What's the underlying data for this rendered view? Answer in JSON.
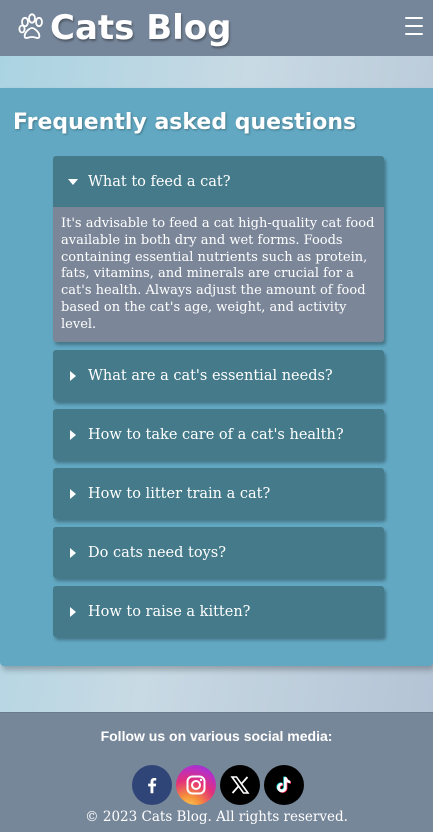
{
  "header": {
    "brand": "Cats Blog",
    "logo_icon": "paw-icon",
    "menu_icon": "hamburger-menu-icon"
  },
  "faq": {
    "title": "Frequently asked questions",
    "items": [
      {
        "question": "What to feed a cat?",
        "expanded": true,
        "answer": "It's advisable to feed a cat high-quality cat food available in both dry and wet forms. Foods containing essential nutrients such as protein, fats, vitamins, and minerals are crucial for a cat's health. Always adjust the amount of food based on the cat's age, weight, and activity level."
      },
      {
        "question": "What are a cat's essential needs?",
        "expanded": false
      },
      {
        "question": "How to take care of a cat's health?",
        "expanded": false
      },
      {
        "question": "How to litter train a cat?",
        "expanded": false
      },
      {
        "question": "Do cats need toys?",
        "expanded": false
      },
      {
        "question": "How to raise a kitten?",
        "expanded": false
      }
    ]
  },
  "footer": {
    "follow_text": "Follow us on various social media:",
    "socials": [
      {
        "name": "facebook",
        "icon": "facebook-icon",
        "color": "#2f4577"
      },
      {
        "name": "instagram",
        "icon": "instagram-icon",
        "color": "#e2307a"
      },
      {
        "name": "x",
        "icon": "x-icon",
        "color": "#000000"
      },
      {
        "name": "tiktok",
        "icon": "tiktok-icon",
        "color": "#000000"
      }
    ],
    "copyright": "© 2023 Cats Blog. All rights reserved."
  },
  "colors": {
    "header_bg": "#76869a",
    "panel_bg": "#62a8c2",
    "question_bg": "#447a89",
    "answer_bg": "#7b8799"
  }
}
